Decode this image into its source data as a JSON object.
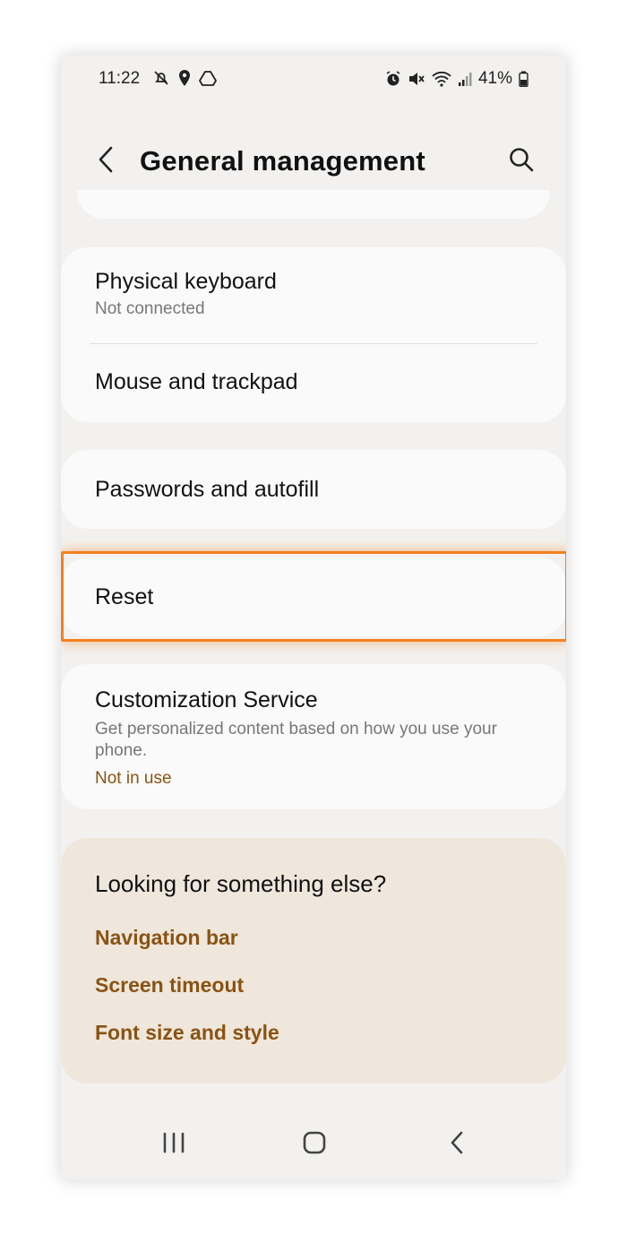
{
  "status_bar": {
    "time": "11:22",
    "battery": "41%",
    "left_icons": [
      "notifications-off-icon",
      "location-icon",
      "drive-icon"
    ],
    "right_icons": [
      "alarm-icon",
      "mute-icon",
      "wifi-icon",
      "signal-icon",
      "battery-icon"
    ]
  },
  "header": {
    "title": "General management",
    "back_icon": "chevron-left-icon",
    "search_icon": "search-icon"
  },
  "settings": {
    "physical_keyboard": {
      "title": "Physical keyboard",
      "subtitle": "Not connected"
    },
    "mouse_trackpad": {
      "title": "Mouse and trackpad"
    },
    "passwords_autofill": {
      "title": "Passwords and autofill"
    },
    "reset": {
      "title": "Reset"
    },
    "customization": {
      "title": "Customization Service",
      "subtitle": "Get personalized content based on how you use your phone.",
      "status": "Not in use"
    }
  },
  "suggestions": {
    "title": "Looking for something else?",
    "links": [
      "Navigation bar",
      "Screen timeout",
      "Font size and style"
    ]
  },
  "colors": {
    "accent": "#8a5313",
    "highlight": "#f3801f",
    "background": "#f2f1ef",
    "card": "#fafafa",
    "suggest_bg": "#efe7dc"
  },
  "nav_bar": {
    "icons": [
      "recents-icon",
      "home-icon",
      "back-icon"
    ]
  }
}
